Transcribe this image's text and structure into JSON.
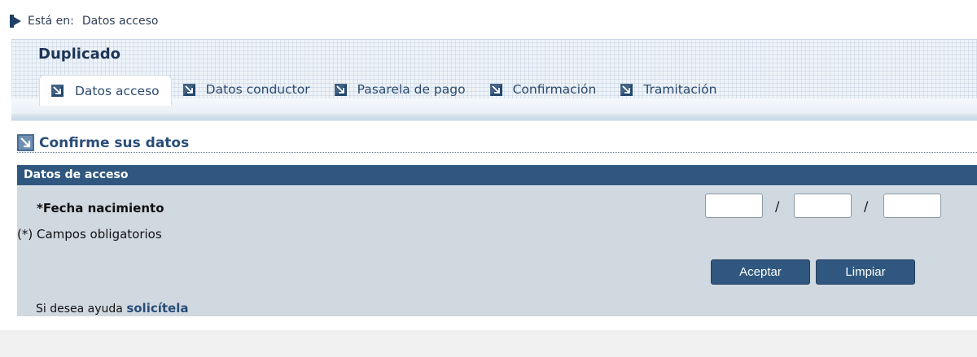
{
  "breadcrumb": {
    "prefix": "Está en:",
    "current": "Datos acceso"
  },
  "header": {
    "title": "Duplicado"
  },
  "tabs": [
    {
      "label": "Datos acceso",
      "active": true
    },
    {
      "label": "Datos conductor",
      "active": false
    },
    {
      "label": "Pasarela de pago",
      "active": false
    },
    {
      "label": "Confirmación",
      "active": false
    },
    {
      "label": "Tramitación",
      "active": false
    }
  ],
  "section": {
    "title": "Confirme sus datos"
  },
  "form": {
    "header": "Datos de acceso",
    "birthdate_label": "*Fecha nacimiento",
    "separator": "/",
    "day_value": "",
    "month_value": "",
    "year_value": "",
    "required_note": "(*) Campos obligatorios",
    "accept_label": "Aceptar",
    "clear_label": "Limpiar"
  },
  "help": {
    "text": "Si desea ayuda",
    "link": "solicítela"
  },
  "colors": {
    "primary": "#2f577f",
    "form_background": "#d0d8e0",
    "link": "#2a4d78"
  },
  "icons": {
    "breadcrumb": "play-arrow-icon",
    "tab": "arrow-square-icon"
  }
}
